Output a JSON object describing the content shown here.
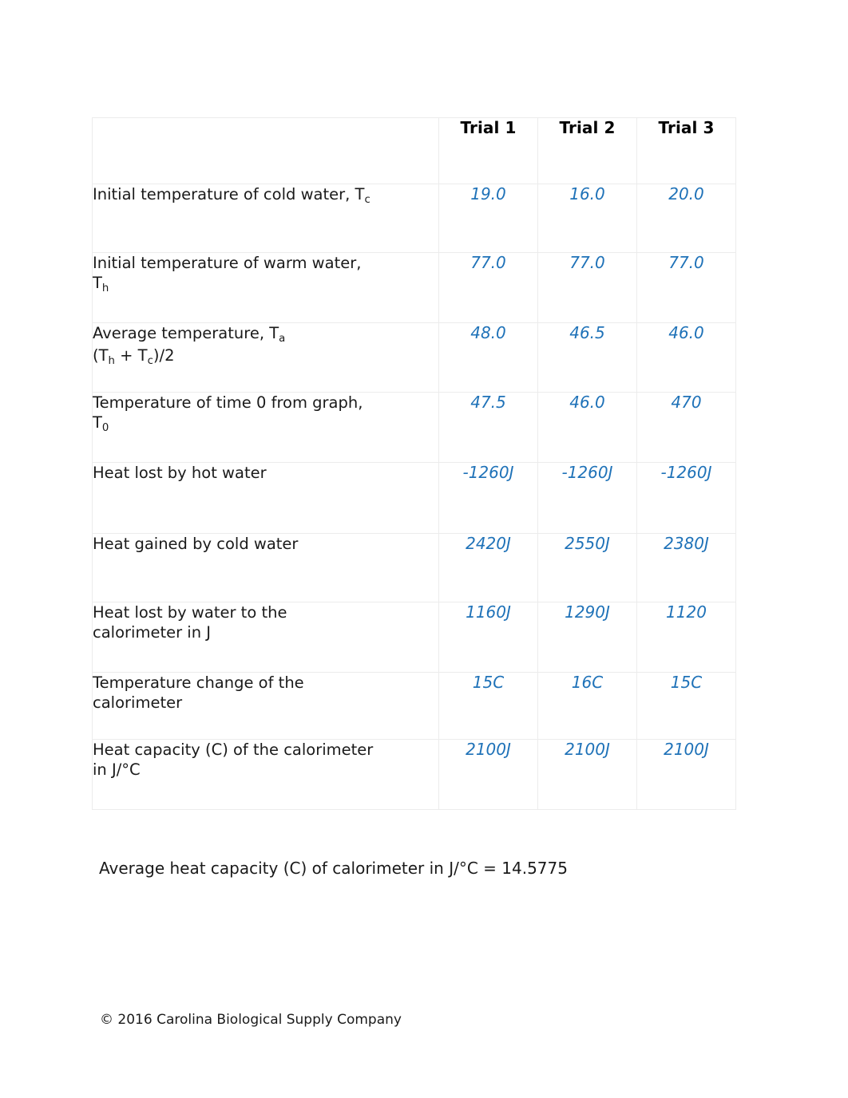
{
  "document": {
    "table": {
      "column_headers": [
        "",
        "Trial 1",
        "Trial 2",
        "Trial 3"
      ],
      "rows": [
        {
          "label_line1": "Initial temperature of cold water, T",
          "label_sub1": "c",
          "label_line2": "",
          "label_sub2": "",
          "values": [
            "19.0",
            "16.0",
            "20.0"
          ]
        },
        {
          "label_line1": "Initial temperature of warm water,",
          "label_sub1": "",
          "label_line2": "T",
          "label_sub2": "h",
          "values": [
            "77.0",
            "77.0",
            "77.0"
          ]
        },
        {
          "label_line1": "Average temperature, T",
          "label_sub1": "a",
          "label_line2": "(T",
          "label_sub2": "h",
          "label_line2b": " + T",
          "label_sub2b": "c",
          "label_line2c": ")/2",
          "values": [
            "48.0",
            "46.5",
            "46.0"
          ]
        },
        {
          "label_line1": "Temperature of time 0 from graph,",
          "label_sub1": "",
          "label_line2": "T",
          "label_sub2": "0",
          "values": [
            "47.5",
            "46.0",
            "470"
          ]
        },
        {
          "label_line1": "Heat lost by hot water",
          "label_sub1": "",
          "label_line2": "",
          "label_sub2": "",
          "values": [
            "-1260J",
            "-1260J",
            "-1260J"
          ]
        },
        {
          "label_line1": "Heat gained by cold water",
          "label_sub1": "",
          "label_line2": "",
          "label_sub2": "",
          "values": [
            "2420J",
            "2550J",
            "2380J"
          ]
        },
        {
          "label_line1": "Heat lost by water to the",
          "label_sub1": "",
          "label_line2": "calorimeter in J",
          "label_sub2": "",
          "values": [
            "1160J",
            "1290J",
            "1120"
          ]
        },
        {
          "label_line1": "Temperature change of the",
          "label_sub1": "",
          "label_line2": "calorimeter",
          "label_sub2": "",
          "values": [
            "15C",
            "16C",
            "15C"
          ]
        },
        {
          "label_line1": "Heat capacity (C) of the calorimeter",
          "label_sub1": "",
          "label_line2": "in J/°C",
          "label_sub2": "",
          "values": [
            "2100J",
            "2100J",
            "2100J"
          ]
        }
      ]
    },
    "average_line": "Average heat capacity (C) of calorimeter in J/°C = 14.5775",
    "footer": "© 2016 Carolina Biological Supply Company",
    "colors": {
      "value_blue": "#1f72b8",
      "text_black": "#1a1a1a",
      "border_gray": "#ececec"
    }
  }
}
